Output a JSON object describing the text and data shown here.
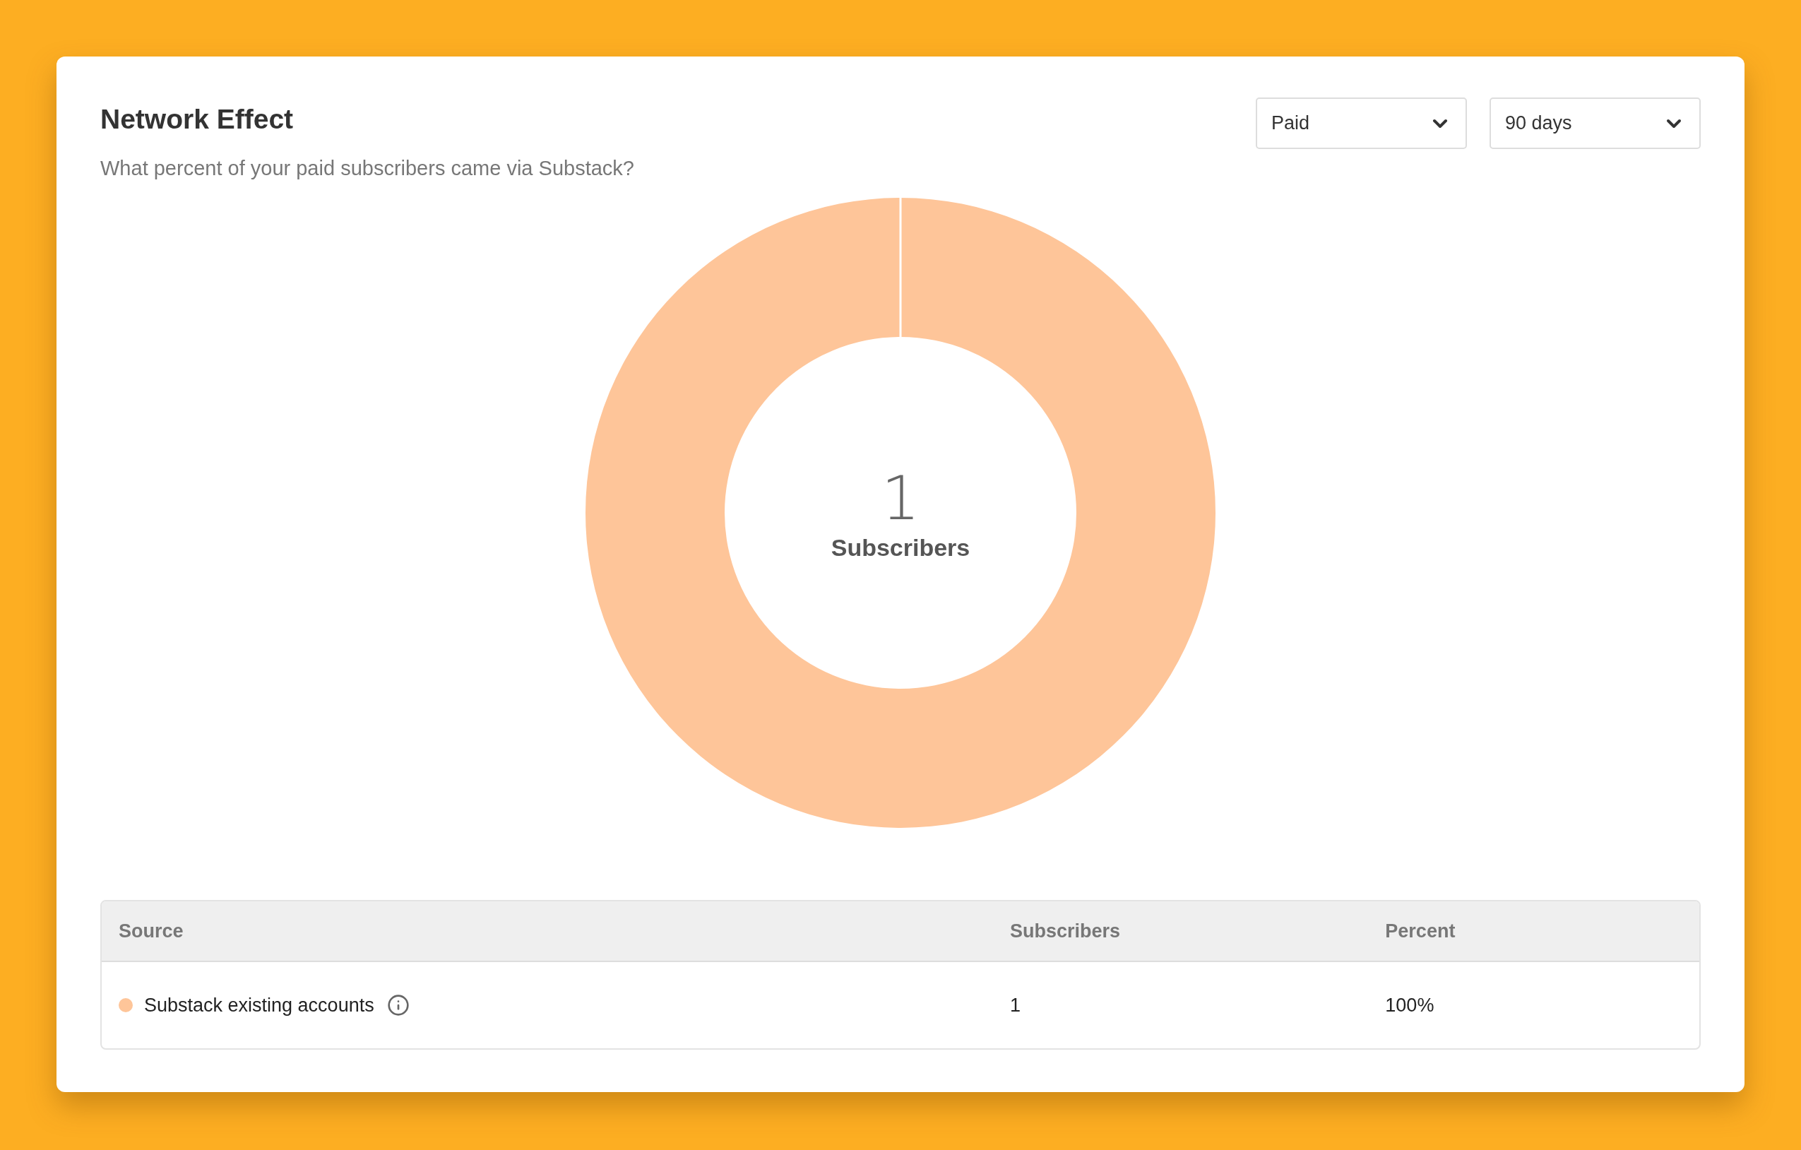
{
  "card": {
    "title": "Network Effect",
    "subtitle": "What percent of your paid subscribers came via Substack?"
  },
  "dropdowns": [
    {
      "value": "Paid"
    },
    {
      "value": "90 days"
    }
  ],
  "chart": {
    "center_value": "1",
    "center_label": "Subscribers"
  },
  "table": {
    "columns": [
      "Source",
      "Subscribers",
      "Percent"
    ],
    "rows": [
      {
        "source": "Substack existing accounts",
        "color": "#fec599",
        "subscribers": "1",
        "percent": "100%"
      }
    ]
  }
}
